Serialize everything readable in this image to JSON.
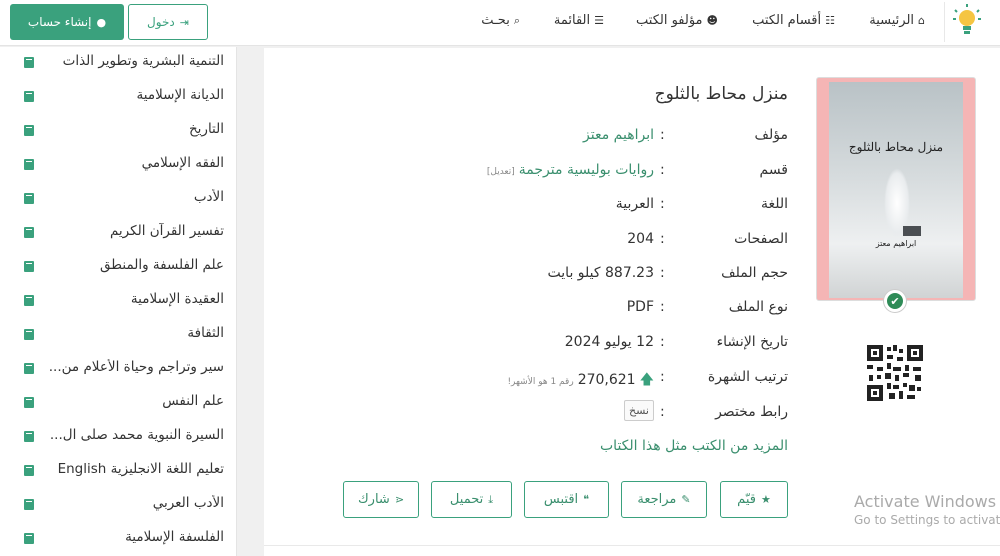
{
  "nav": {
    "home": "الرئيسية",
    "sections": "أقسام الكتب",
    "authors": "مؤلفو الكتب",
    "menu": "القائمة",
    "search": "بحـث",
    "login": "دخول",
    "register": "إنشاء حساب"
  },
  "sidebar": {
    "items": [
      "التنمية البشرية وتطوير الذات",
      "الديانة الإسلامية",
      "التاريخ",
      "الفقه الإسلامي",
      "الأدب",
      "تفسير القرآن الكريم",
      "علم الفلسفة والمنطق",
      "العقيدة الإسلامية",
      "الثقافة",
      "سير وتراجم وحياة الأعلام من...",
      "علم النفس",
      "السيرة النبوية محمد صلى ال...",
      "تعليم اللغة الانجليزية English",
      "الأدب العربي",
      "الفلسفة الإسلامية"
    ]
  },
  "book": {
    "title": "منزل محاط بالثلوج",
    "cover_title": "منزل محاط بالثلوج",
    "cover_author": "ابراهيم معتز",
    "author_label": "مؤلف",
    "author": "ابراهيم معتز",
    "section_label": "قسم",
    "section": "روايات بوليسية مترجمة",
    "edit": "[تعديل]",
    "language_label": "اللغة",
    "language": "العربية",
    "pages_label": "الصفحات",
    "pages": "204",
    "size_label": "حجم الملف",
    "size": "887.23 كيلو بايت",
    "type_label": "نوع الملف",
    "type": "PDF",
    "created_label": "تاريخ الإنشاء",
    "created": "12 يوليو 2024",
    "rank_label": "ترتيب الشهرة",
    "rank": "270,621",
    "rank_note": "رقم 1 هو الأشهر!",
    "short_label": "رابط مختصر",
    "copy": "نسخ",
    "more": "المزيد من الكتب مثل هذا الكتاب"
  },
  "actions": {
    "rate": "قيّم",
    "review": "مراجعة",
    "quote": "اقتبس",
    "download": "تحميل",
    "share": "شارك"
  },
  "colon": ":",
  "windows": {
    "line1": "Activate Windows",
    "line2": "Go to Settings to activate"
  },
  "colors": {
    "accent": "#3aa17d",
    "link": "#3a8f6e",
    "cover_bg": "#f5b5b5"
  }
}
